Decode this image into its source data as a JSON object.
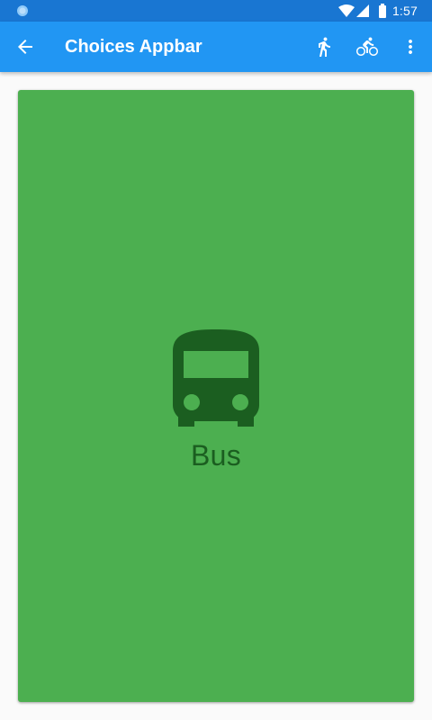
{
  "status_bar": {
    "time": "1:57",
    "icons": [
      "notification-dot-icon",
      "wifi-icon",
      "cell-signal-icon",
      "battery-icon"
    ]
  },
  "app_bar": {
    "title": "Choices Appbar",
    "navigation_icon": "arrow-back-icon",
    "actions": [
      "directions-walk-icon",
      "directions-bike-icon",
      "more-vert-icon"
    ],
    "color": "#2196f3",
    "status_color": "#1976d2"
  },
  "card": {
    "label": "Bus",
    "icon": "directions-bus-icon",
    "color": "#4caf50",
    "content_color": "#1b5e20"
  }
}
